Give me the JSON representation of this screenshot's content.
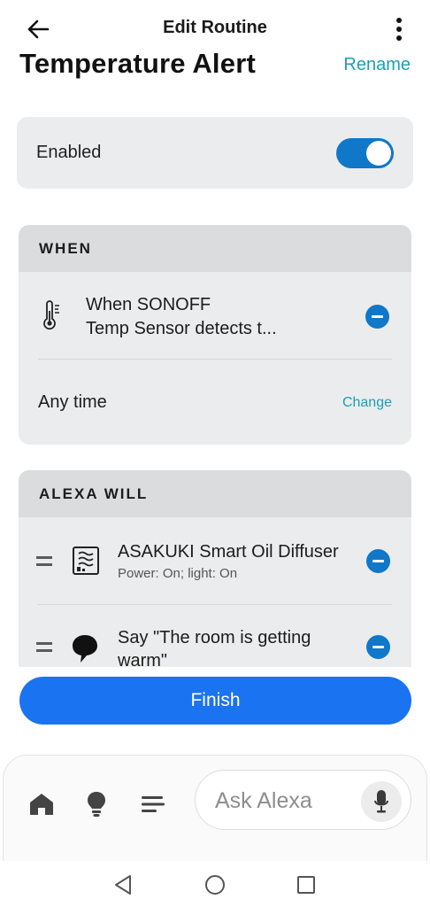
{
  "header": {
    "title": "Edit Routine",
    "routine_name": "Temperature Alert",
    "rename_label": "Rename"
  },
  "enabled": {
    "label": "Enabled",
    "on": true
  },
  "when": {
    "title": "WHEN",
    "trigger_line1": "When SONOFF",
    "trigger_line2": "Temp Sensor detects t...",
    "trigger_icon": "thermometer-icon",
    "schedule_label": "Any time",
    "change_label": "Change"
  },
  "alexa_will": {
    "title": "ALEXA WILL",
    "actions": [
      {
        "title": "ASAKUKI Smart Oil Diffuser",
        "subtitle": "Power: On; light: On",
        "icon": "diffuser-icon"
      },
      {
        "title_line1": "Say \"The room is getting",
        "title_line2": "warm\"",
        "icon": "speech-bubble-icon"
      }
    ]
  },
  "finish_label": "Finish",
  "bottom_bar": {
    "ask_placeholder": "Ask Alexa",
    "icons": [
      "home-icon",
      "lightbulb-icon",
      "list-icon",
      "microphone-icon"
    ]
  },
  "colors": {
    "accent_blue": "#1077c9",
    "link_teal": "#1a9fb6",
    "finish_blue": "#1a73f0"
  }
}
